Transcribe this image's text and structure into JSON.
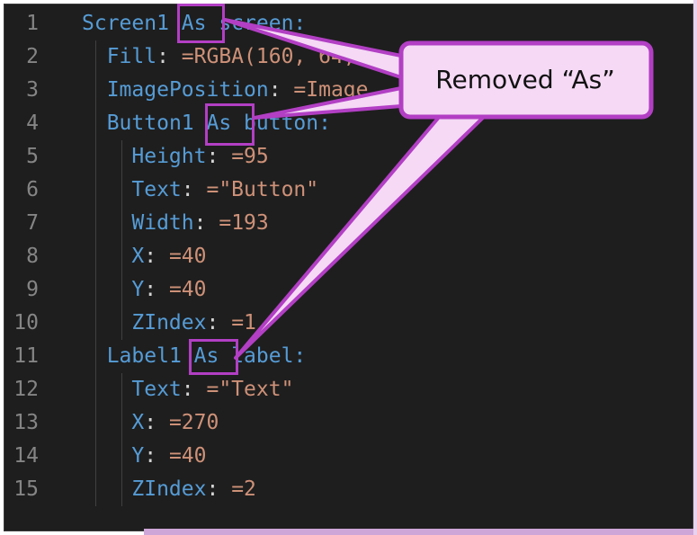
{
  "editor": {
    "lines": [
      {
        "num": "1",
        "indent": "",
        "key": "Screen1",
        "mid": " As ",
        "rest": "screen:",
        "val": ""
      },
      {
        "num": "2",
        "indent": "  ",
        "key": "Fill",
        "mid": ": ",
        "rest": "",
        "val": "=RGBA(160, 64,"
      },
      {
        "num": "3",
        "indent": "  ",
        "key": "ImagePosition",
        "mid": ": ",
        "rest": "",
        "val": "=Image"
      },
      {
        "num": "4",
        "indent": "  ",
        "key": "Button1",
        "mid": " As ",
        "rest": "button:",
        "val": ""
      },
      {
        "num": "5",
        "indent": "    ",
        "key": "Height",
        "mid": ": ",
        "rest": "",
        "val": "=95"
      },
      {
        "num": "6",
        "indent": "    ",
        "key": "Text",
        "mid": ": ",
        "rest": "",
        "val": "=\"Button\""
      },
      {
        "num": "7",
        "indent": "    ",
        "key": "Width",
        "mid": ": ",
        "rest": "",
        "val": "=193"
      },
      {
        "num": "8",
        "indent": "    ",
        "key": "X",
        "mid": ": ",
        "rest": "",
        "val": "=40"
      },
      {
        "num": "9",
        "indent": "    ",
        "key": "Y",
        "mid": ": ",
        "rest": "",
        "val": "=40"
      },
      {
        "num": "10",
        "indent": "    ",
        "key": "ZIndex",
        "mid": ": ",
        "rest": "",
        "val": "=1"
      },
      {
        "num": "11",
        "indent": "  ",
        "key": "Label1",
        "mid": " As ",
        "rest": "label:",
        "val": ""
      },
      {
        "num": "12",
        "indent": "    ",
        "key": "Text",
        "mid": ": ",
        "rest": "",
        "val": "=\"Text\""
      },
      {
        "num": "13",
        "indent": "    ",
        "key": "X",
        "mid": ": ",
        "rest": "",
        "val": "=270"
      },
      {
        "num": "14",
        "indent": "    ",
        "key": "Y",
        "mid": ": ",
        "rest": "",
        "val": "=40"
      },
      {
        "num": "15",
        "indent": "    ",
        "key": "ZIndex",
        "mid": ": ",
        "rest": "",
        "val": "=2"
      }
    ]
  },
  "callout": {
    "text": "Removed “As”",
    "accent_color": "#b23fc4",
    "fill_color": "#f5d9f5"
  },
  "colors": {
    "background": "#1e1e1e",
    "key": "#569cd6",
    "value": "#ce9178",
    "line_number": "#858585"
  }
}
